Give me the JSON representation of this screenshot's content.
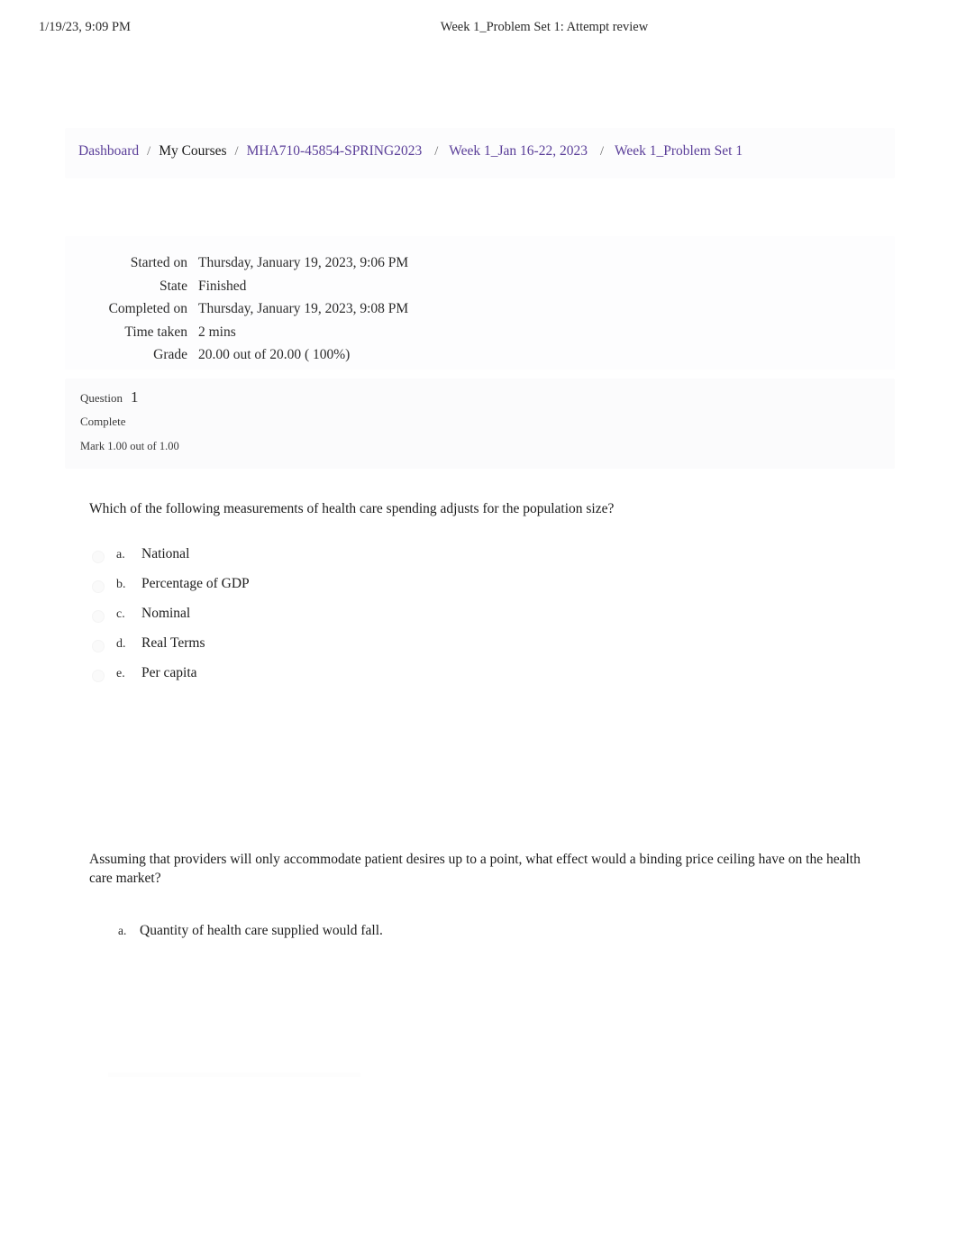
{
  "print_header": {
    "date": "1/19/23, 9:09 PM",
    "title": "Week 1_Problem Set 1: Attempt review"
  },
  "breadcrumb": {
    "separator": "/",
    "items": [
      {
        "label": "Dashboard",
        "link": true
      },
      {
        "label": "My Courses",
        "link": false
      },
      {
        "label": "MHA710-45854-SPRING2023",
        "link": true
      },
      {
        "label": "Week 1_Jan 16-22, 2023",
        "link": true
      },
      {
        "label": "Week 1_Problem Set 1",
        "link": true
      }
    ]
  },
  "attempt_info": {
    "rows": [
      {
        "label": "Started on",
        "value": "Thursday, January 19, 2023, 9:06 PM"
      },
      {
        "label": "State",
        "value": "Finished"
      },
      {
        "label": "Completed on",
        "value": "Thursday, January 19, 2023, 9:08 PM"
      },
      {
        "label": "Time taken",
        "value": "2 mins"
      },
      {
        "label": "Grade",
        "value": "20.00  out of 20.00 (  100%)"
      }
    ]
  },
  "question_header": {
    "question_label": "Question",
    "question_number": "1",
    "state": "Complete",
    "mark": "Mark 1.00 out of 1.00"
  },
  "questions": [
    {
      "text": "Which of the following measurements of health care spending adjusts for the population size?",
      "answers": [
        {
          "letter": "a.",
          "text": "National"
        },
        {
          "letter": "b.",
          "text": "Percentage of GDP"
        },
        {
          "letter": "c.",
          "text": "Nominal"
        },
        {
          "letter": "d.",
          "text": "Real Terms"
        },
        {
          "letter": "e.",
          "text": "Per capita"
        }
      ]
    },
    {
      "text": "Assuming that providers will only accommodate patient desires up to a point, what effect would a binding price ceiling have on the health care market?",
      "answers": [
        {
          "letter": "a.",
          "text": "Quantity of health care supplied would fall."
        }
      ]
    }
  ],
  "colors": {
    "link_purple": "#5b3f99",
    "body_text": "#1c1c1c",
    "muted_text": "#3a3a3a",
    "panel_wash": "#fcfcfd",
    "page_background": "#ffffff"
  }
}
